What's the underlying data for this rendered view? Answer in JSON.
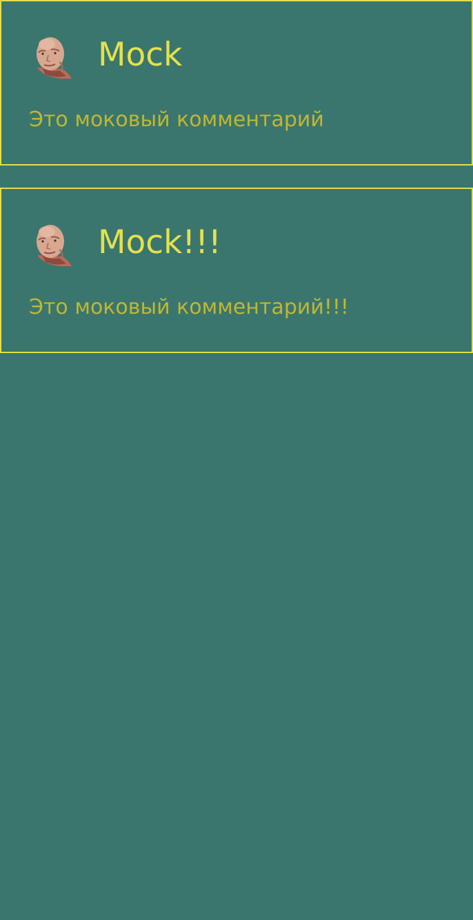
{
  "theme": {
    "background": "#3a766e",
    "border": "#e1df4a",
    "author_color": "#e5e14c",
    "comment_color": "#c1b732"
  },
  "comments": [
    {
      "author": "Mock",
      "text": "Это моковый комментарий",
      "avatar_icon": "user-avatar-photo"
    },
    {
      "author": "Mock!!!",
      "text": "Это моковый комментарий!!!",
      "avatar_icon": "user-avatar-photo"
    }
  ]
}
